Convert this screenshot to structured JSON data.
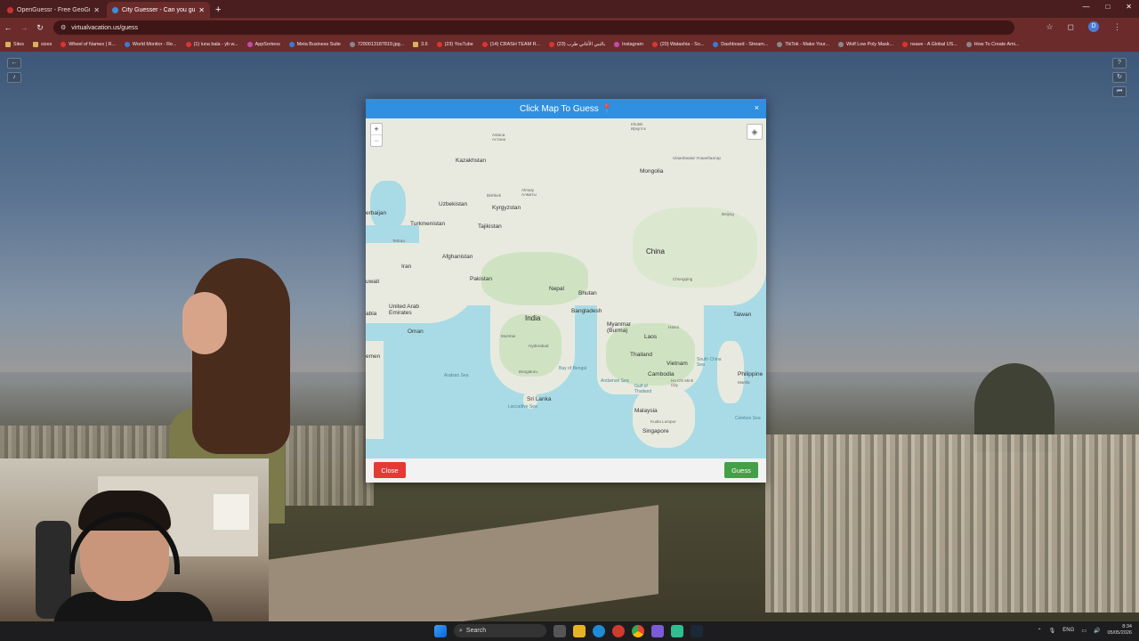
{
  "browser": {
    "tabs": [
      {
        "title": "OpenGuessr - Free GeoGuessr",
        "active": false
      },
      {
        "title": "City Guesser - Can you gue",
        "active": true
      }
    ],
    "new_tab_glyph": "+",
    "window_controls": [
      "—",
      "□",
      "✕"
    ],
    "url": "virtualvacation.us/guess",
    "profile_initial": "D",
    "bookmarks": [
      "Sites",
      "sizes",
      "Wheel of Names | R...",
      "World Monitor - Re...",
      "(1) luna bala - yb w...",
      "AppSorteos",
      "Meta Business Suite",
      "7290013187819.jpg...",
      "3.6",
      "(23) YouTube",
      "(14) CRASH TEAM R...",
      "(23) بالنبي الأغاني طرب",
      "Instagram",
      "(20) Watashia - So...",
      "Dashboard - Stream...",
      "TikTok - Make Your...",
      "Wolf Low Poly Mask...",
      "nsave - A Global US...",
      "How To Create Ami..."
    ]
  },
  "modal": {
    "title": "Click Map To Guess",
    "close_x": "×",
    "close_button": "Close",
    "guess_button": "Guess",
    "zoom_in": "+",
    "zoom_out": "−"
  },
  "map": {
    "countries": [
      {
        "label": "Kazakhstan",
        "big": false
      },
      {
        "label": "Mongolia",
        "big": false
      },
      {
        "label": "Uzbekistan",
        "big": false
      },
      {
        "label": "Kyrgyzstan",
        "big": false
      },
      {
        "label": "Turkmenistan",
        "big": false
      },
      {
        "label": "Tajikistan",
        "big": false
      },
      {
        "label": "Afghanistan",
        "big": false
      },
      {
        "label": "Iran",
        "big": false
      },
      {
        "label": "Pakistan",
        "big": false
      },
      {
        "label": "China",
        "big": true
      },
      {
        "label": "Nepal",
        "big": false
      },
      {
        "label": "Bhutan",
        "big": false
      },
      {
        "label": "India",
        "big": true
      },
      {
        "label": "Bangladesh",
        "big": false
      },
      {
        "label": "Myanmar (Burma)",
        "big": false
      },
      {
        "label": "Laos",
        "big": false
      },
      {
        "label": "Thailand",
        "big": false
      },
      {
        "label": "Vietnam",
        "big": false
      },
      {
        "label": "Cambodia",
        "big": false
      },
      {
        "label": "Taiwan",
        "big": false
      },
      {
        "label": "Philippine",
        "big": false
      },
      {
        "label": "Sri Lanka",
        "big": false
      },
      {
        "label": "Malaysia",
        "big": false
      },
      {
        "label": "Singapore",
        "big": false
      },
      {
        "label": "United Arab Emirates",
        "big": false
      },
      {
        "label": "Oman",
        "big": false
      },
      {
        "label": "emen",
        "big": false
      },
      {
        "label": "uwait",
        "big": false
      },
      {
        "label": "abia",
        "big": false
      },
      {
        "label": "erbaijan",
        "big": false
      }
    ],
    "cities": [
      "Astana Астана",
      "Irkutsk Иркутск",
      "Ulaanbaatar Улаанбаатар",
      "Almaty Алматы",
      "Bishkek",
      "Beijing",
      "Tehran",
      "Chongqing",
      "Mumbai",
      "Hyderabad",
      "Bengaluru",
      "Hanoi",
      "Ho Chi Minh City",
      "Kuala Lumpur",
      "Manila"
    ],
    "seas": [
      "Arabian Sea",
      "Bay of Bengal",
      "Andaman Sea",
      "Laccadive Sea",
      "South China Sea",
      "Gulf of Thailand",
      "Celebes Sea"
    ]
  },
  "taskbar": {
    "search_label": "Search",
    "language": "ENG",
    "time": "8:34",
    "date": "05/05/2026"
  }
}
